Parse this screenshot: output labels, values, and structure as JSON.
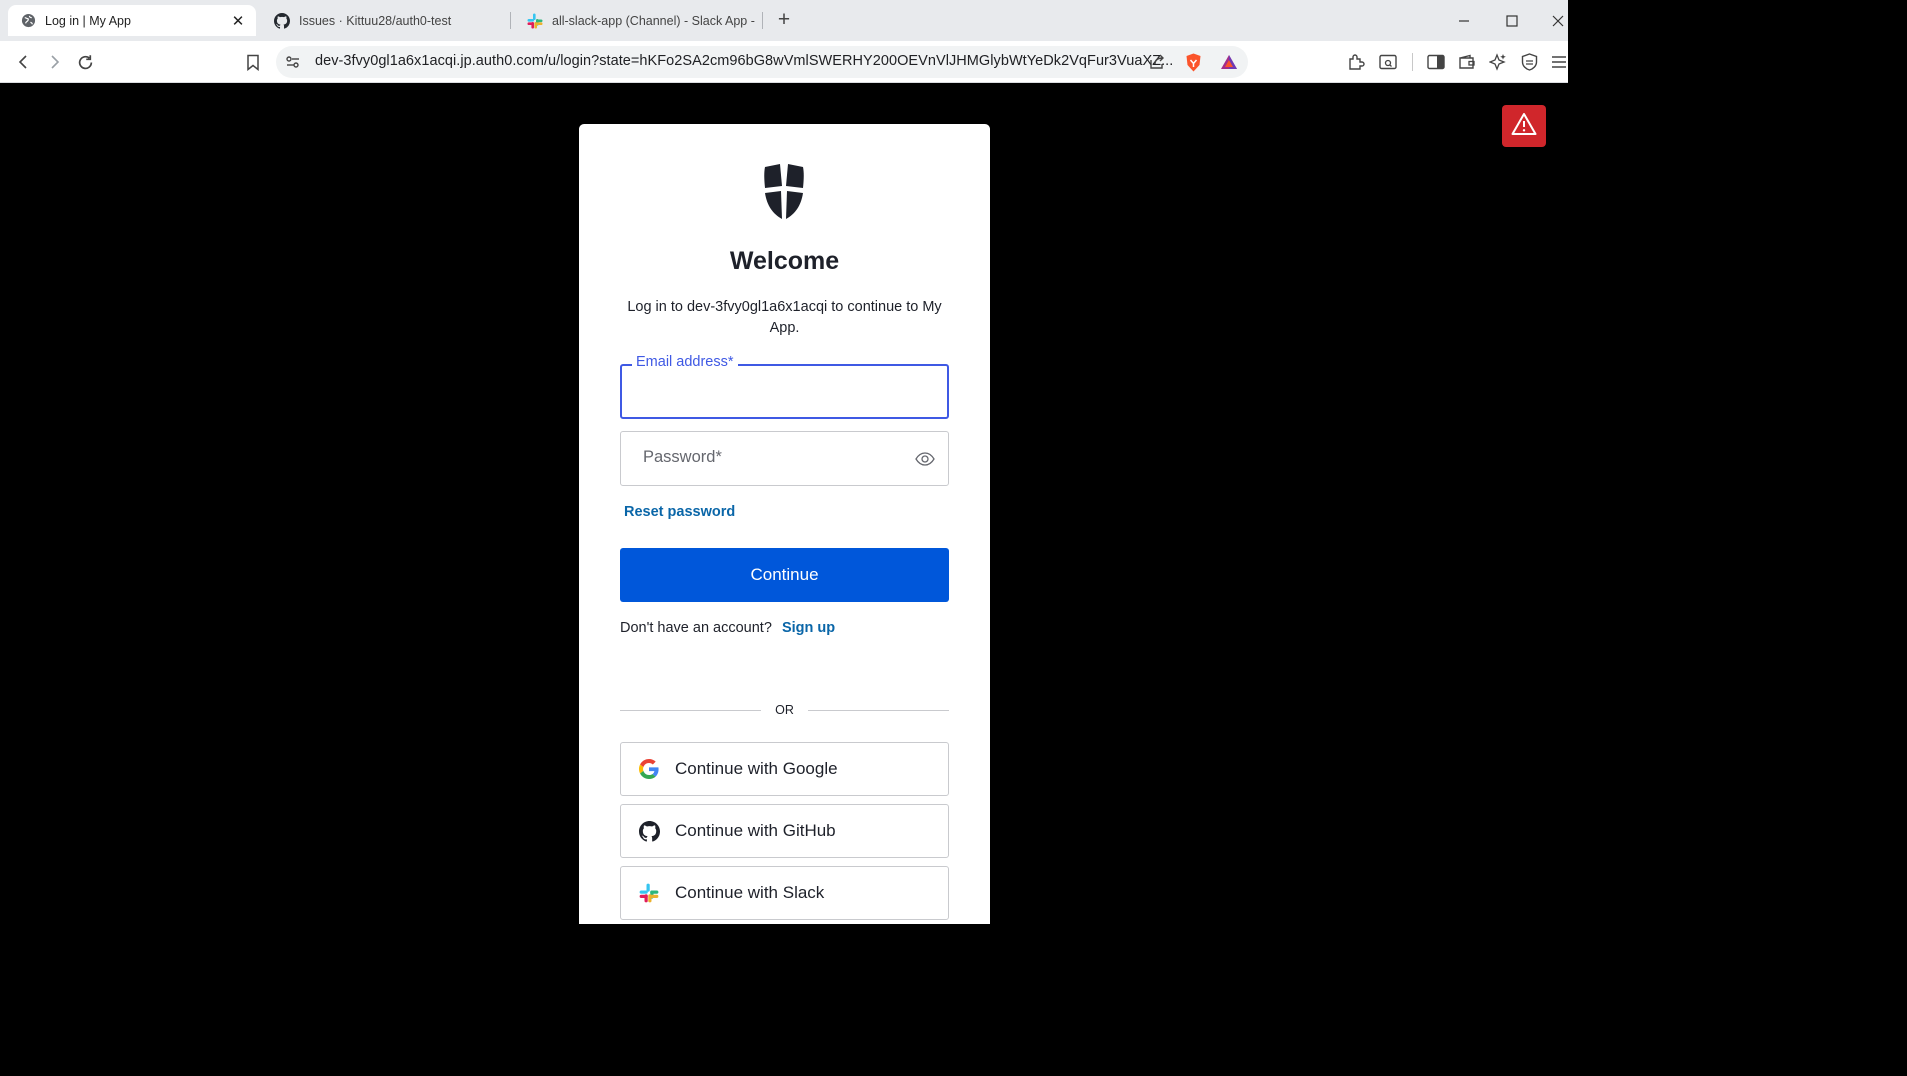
{
  "browser": {
    "tabs": [
      {
        "title": "Log in | My App",
        "active": true
      },
      {
        "title": "Issues · Kittuu28/auth0-test",
        "active": false
      },
      {
        "title": "all-slack-app (Channel) - Slack App -",
        "active": false
      }
    ],
    "url": "dev-3fvy0gl1a6x1acqi.jp.auth0.com/u/login?state=hKFo2SA2cm96bG8wVmlSWERHY200OEVnVlJHMGlybWtYeDk2VqFur3VuaXZ...",
    "icons": [
      "back-icon",
      "forward-icon",
      "reload-icon",
      "bookmark-icon",
      "site-settings-icon",
      "share-icon",
      "brave-shields-icon",
      "brave-rewards-icon",
      "extensions-icon",
      "reading-mode-icon",
      "sidebar-icon",
      "wallet-icon",
      "leo-ai-icon",
      "vpn-icon",
      "menu-icon"
    ]
  },
  "login": {
    "welcome": "Welcome",
    "subtitle": "Log in to dev-3fvy0gl1a6x1acqi to continue to My App.",
    "email_label": "Email address*",
    "email_value": "",
    "password_label": "Password*",
    "password_value": "",
    "reset_password": "Reset password",
    "continue_button": "Continue",
    "no_account_text": "Don't have an account?",
    "signup_link": "Sign up",
    "or_text": "OR",
    "social": {
      "google": "Continue with Google",
      "github": "Continue with GitHub",
      "slack": "Continue with Slack"
    }
  },
  "colors": {
    "primary_button": "#0057da",
    "focus_border": "#3f59e4",
    "link": "#0a66a8",
    "warning_badge": "#d0262b"
  }
}
